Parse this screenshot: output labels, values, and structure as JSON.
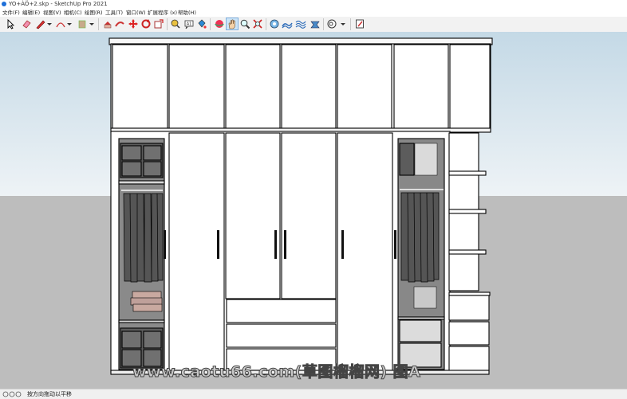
{
  "window": {
    "title": "YO+ÀÖ+2.skp - SketchUp Pro 2021"
  },
  "menu": [
    "文件(F)",
    "编辑(E)",
    "视图(V)",
    "相机(C)",
    "绘图(R)",
    "工具(T)",
    "窗口(W)",
    "扩展程序 (x)",
    "帮助(H)"
  ],
  "toolbar": {
    "tools": [
      "select",
      "eraser",
      "line",
      "arc",
      "rectangle",
      "push-pull",
      "follow-me",
      "move",
      "rotate",
      "scale",
      "offset",
      "tape-measure",
      "text",
      "paint-bucket",
      "orbit",
      "pan",
      "zoom",
      "zoom-extents",
      "add-location",
      "terrain",
      "sandbox",
      "geo",
      "warehouse",
      "extension-warehouse"
    ],
    "active_tool": "pan"
  },
  "status": {
    "text": "按方向拖动以平移"
  },
  "watermark": "www.caotu66.com(草图榴榴网) 图A"
}
